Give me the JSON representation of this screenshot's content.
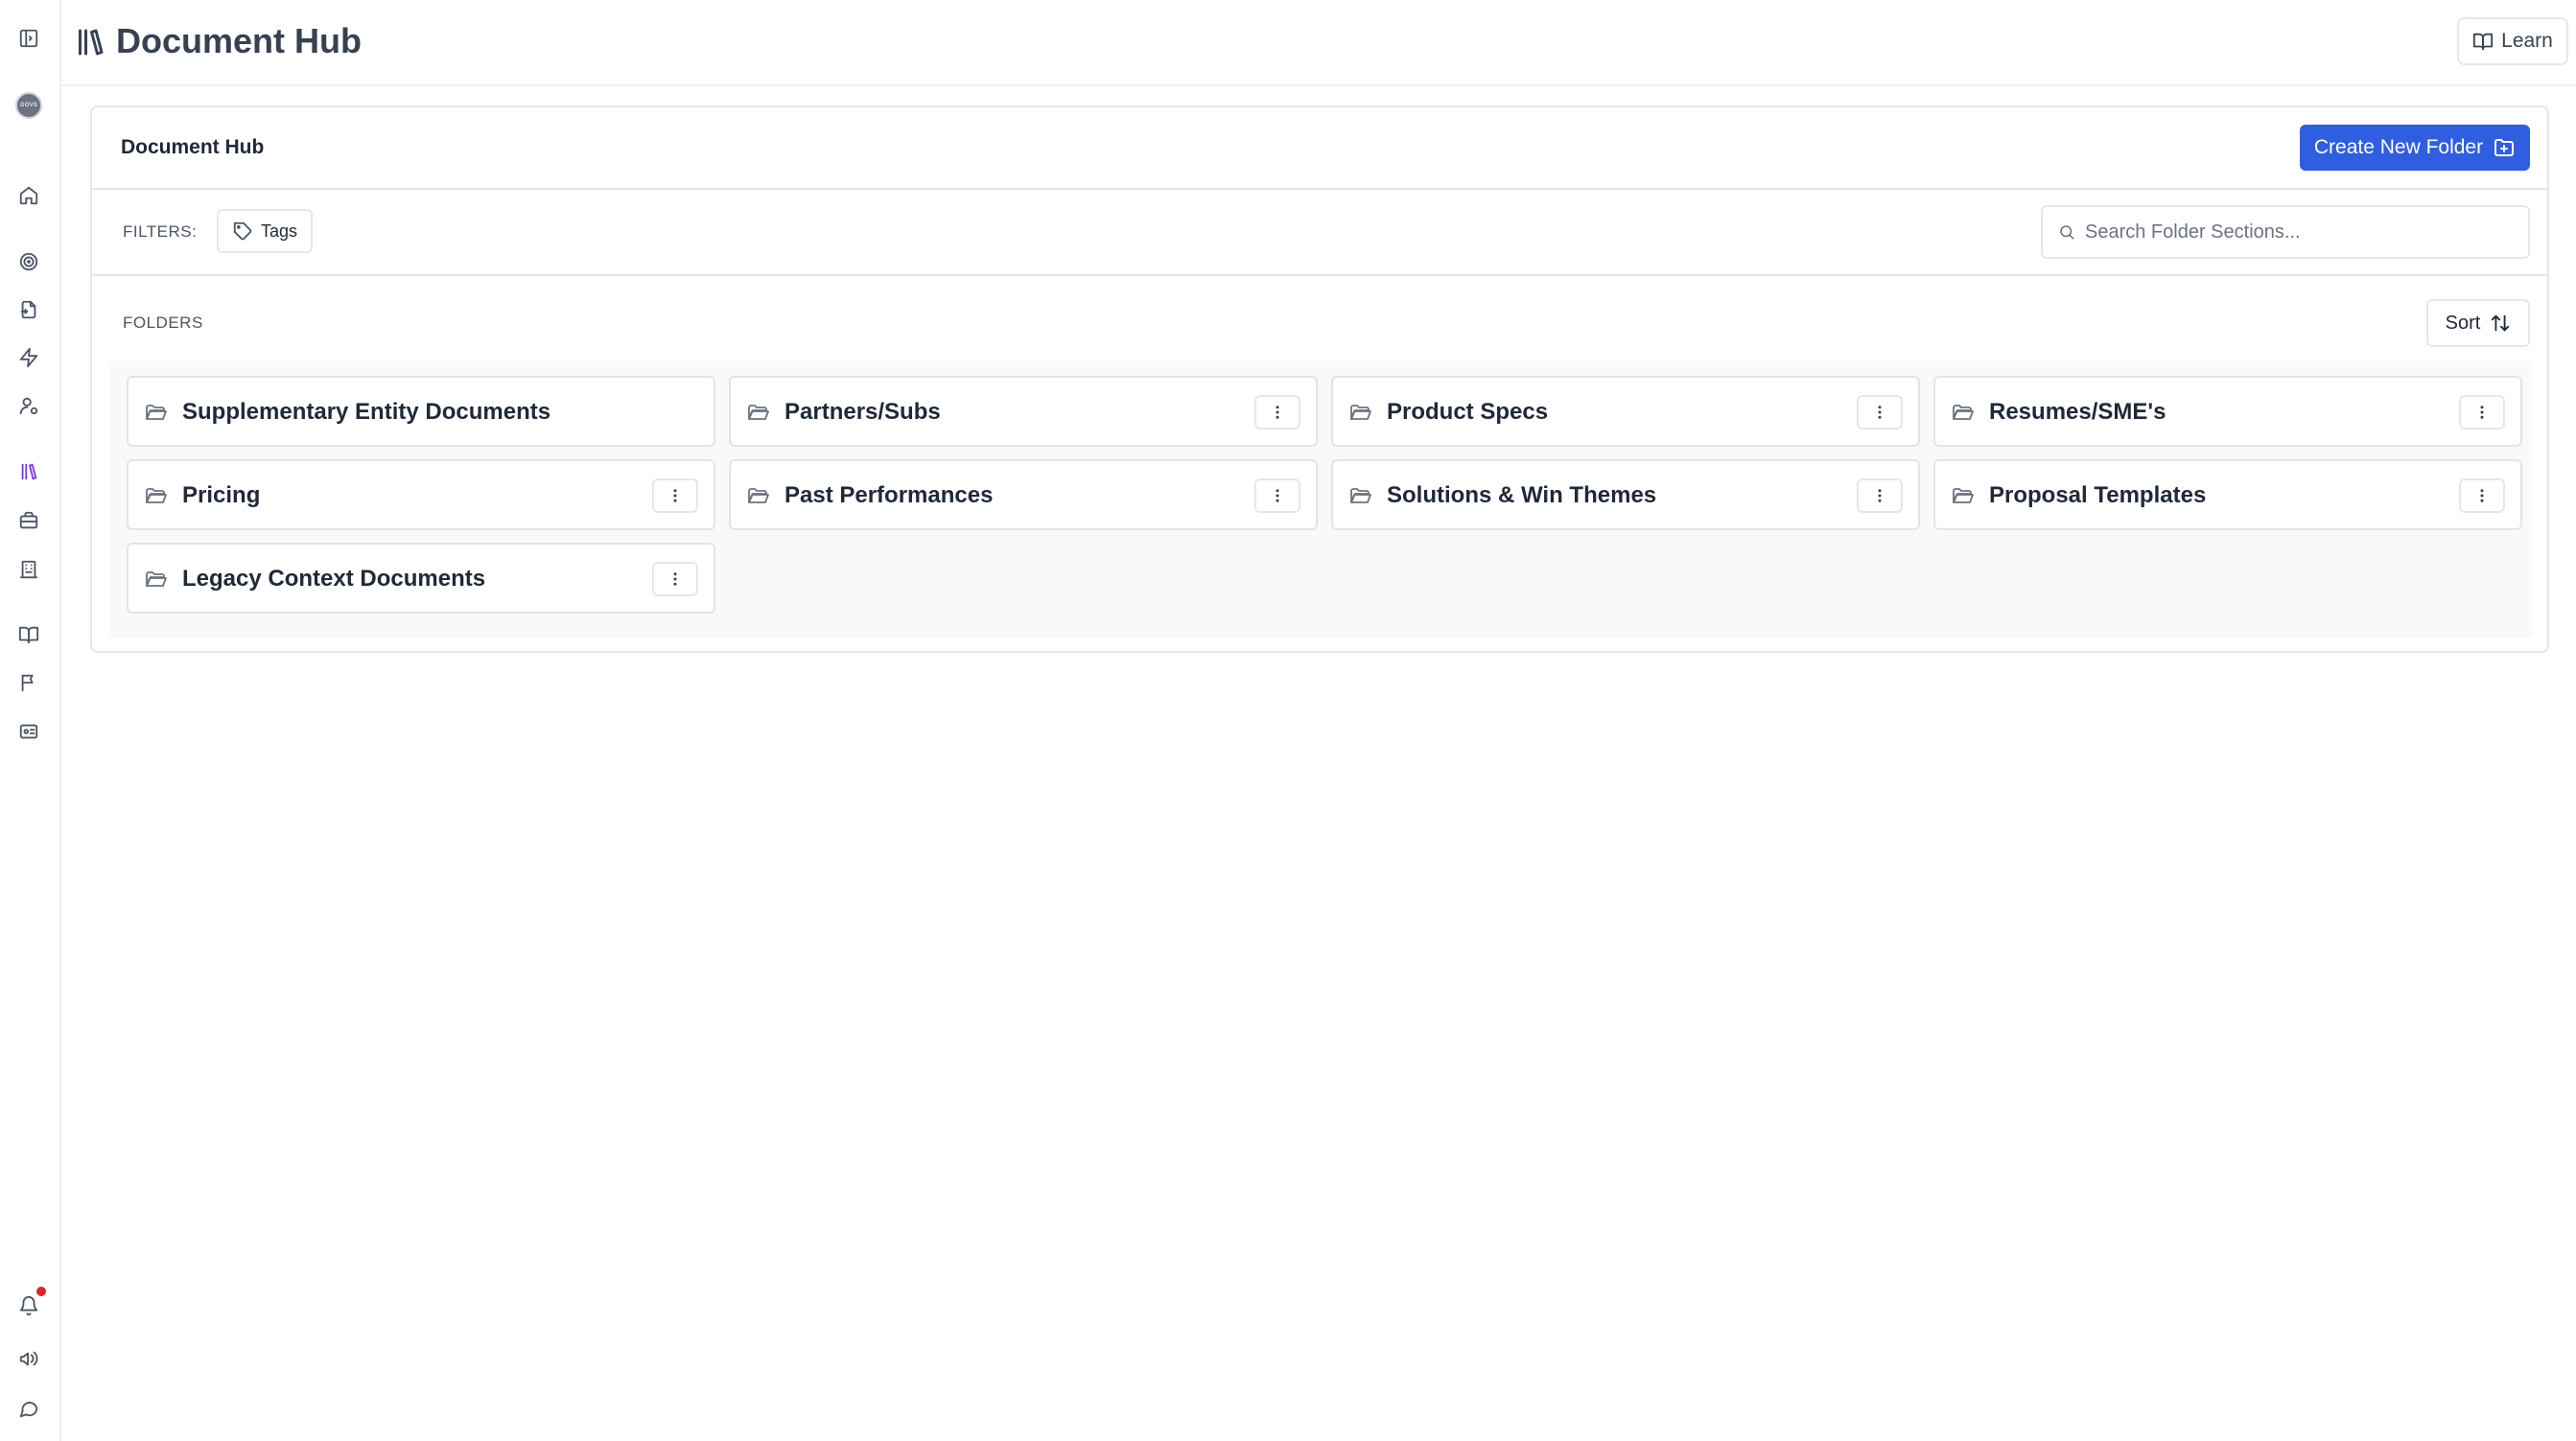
{
  "sidebar": {
    "avatar_text": "GOVS",
    "icons": [
      {
        "name": "panel-toggle-icon"
      },
      {
        "name": "home-icon"
      },
      {
        "name": "target-icon"
      },
      {
        "name": "file-icon"
      },
      {
        "name": "zap-icon"
      },
      {
        "name": "user-icon"
      },
      {
        "name": "library-icon",
        "active": true
      },
      {
        "name": "briefcase-icon"
      },
      {
        "name": "building-icon"
      },
      {
        "name": "book-open-icon"
      },
      {
        "name": "flag-icon"
      },
      {
        "name": "id-card-icon"
      },
      {
        "name": "bell-icon"
      },
      {
        "name": "megaphone-icon"
      },
      {
        "name": "message-icon"
      }
    ],
    "active_color": "#7c3aed",
    "notification_color": "#dc2626"
  },
  "header": {
    "title": "Document Hub",
    "learn_label": "Learn"
  },
  "card": {
    "title": "Document Hub",
    "create_label": "Create New Folder",
    "create_color": "#2f5ee0",
    "filters_label": "FILTERS:",
    "tags_label": "Tags",
    "search_placeholder": "Search Folder Sections...",
    "folders_label": "FOLDERS",
    "sort_label": "Sort",
    "folders": [
      {
        "name": "Supplementary Entity Documents",
        "has_menu": false
      },
      {
        "name": "Partners/Subs",
        "has_menu": true
      },
      {
        "name": "Product Specs",
        "has_menu": true
      },
      {
        "name": "Resumes/SME's",
        "has_menu": true
      },
      {
        "name": "Pricing",
        "has_menu": true
      },
      {
        "name": "Past Performances",
        "has_menu": true
      },
      {
        "name": "Solutions & Win Themes",
        "has_menu": true
      },
      {
        "name": "Proposal Templates",
        "has_menu": true
      },
      {
        "name": "Legacy Context Documents",
        "has_menu": true
      }
    ]
  }
}
